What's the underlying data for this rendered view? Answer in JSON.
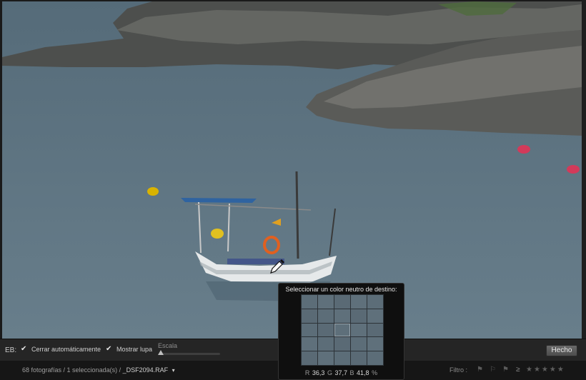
{
  "toolbar": {
    "wb_label": "EB:",
    "auto_dismiss": {
      "label": "Cerrar automáticamente",
      "checked": true
    },
    "show_loupe": {
      "label": "Mostrar lupa",
      "checked": true
    },
    "scale_label": "Escala",
    "scale_value": 0,
    "done_label": "Hecho"
  },
  "loupe": {
    "title": "Seleccionar un color neutro de destino:",
    "r_label": "R",
    "r_value": "36,3",
    "g_label": "G",
    "g_value": "37,7",
    "b_label": "B",
    "b_value": "41,8",
    "unit": "%"
  },
  "filmstrip": {
    "count_text": "68 fotografías / 1 seleccionada(s) /",
    "file_name": "_DSF2094.RAF",
    "caret": "▾",
    "filter_label": "Filtro :",
    "rating_operator": "≥",
    "stars": "★★★★★"
  },
  "icons": [
    "checkbox-icon",
    "eyedropper-icon",
    "flag-icon",
    "star-icon",
    "dropdown-caret-icon"
  ],
  "colors": {
    "panel": "#252525",
    "loupe_bg": "#0f0f0f",
    "water": "#5f7583"
  }
}
